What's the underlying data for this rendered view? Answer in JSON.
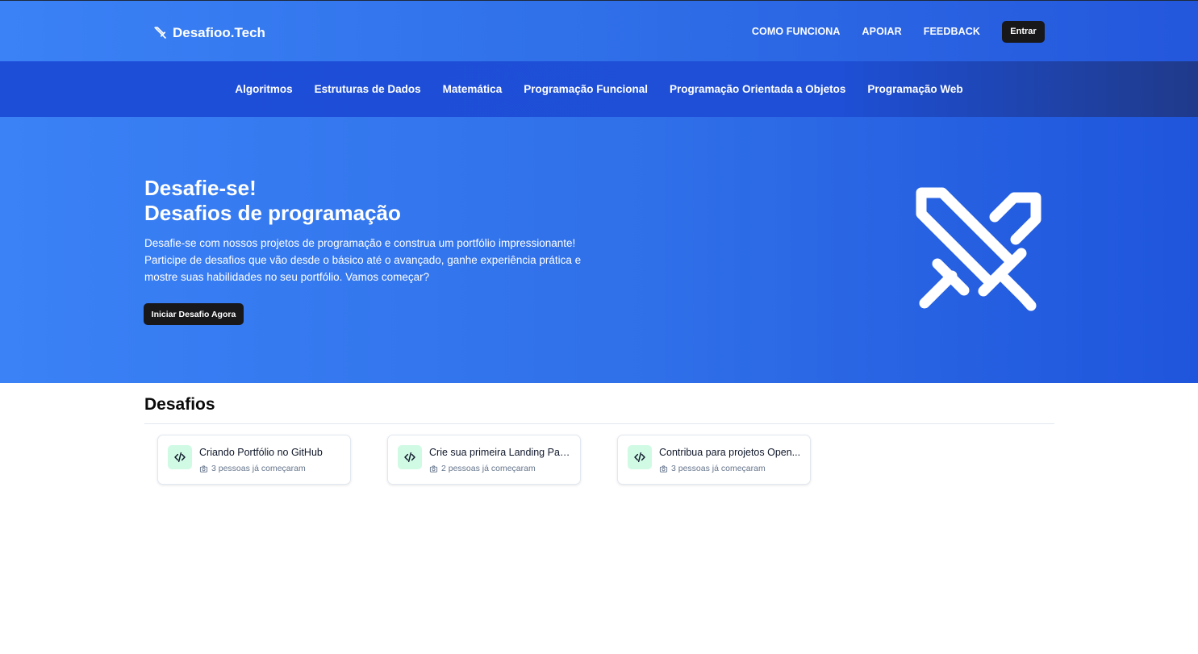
{
  "header": {
    "brand": "Desafioo.Tech",
    "brand_icon": "sword-icon",
    "nav": [
      "COMO FUNCIONA",
      "APOIAR",
      "FEEDBACK"
    ],
    "login_label": "Entrar"
  },
  "categories": [
    "Algoritmos",
    "Estruturas de Dados",
    "Matemática",
    "Programação Funcional",
    "Programação Orientada a Objetos",
    "Programação Web"
  ],
  "hero": {
    "title_line1": "Desafie-se!",
    "title_line2": "Desafios de programação",
    "description": "Desafie-se com nossos projetos de programação e construa um portfólio impressionante! Participe de desafios que vão desde o básico até o avançado, ganhe experiência prática e mostre suas habilidades no seu portfólio. Vamos começar?",
    "cta_label": "Iniciar Desafio Agora",
    "illustration_icon": "crossed-swords-icon"
  },
  "challenges": {
    "section_title": "Desafios",
    "items": [
      {
        "title": "Criando Portfólio no GitHub",
        "meta": "3 pessoas já começaram",
        "icon": "code-icon"
      },
      {
        "title": "Crie sua primeira Landing Pag...",
        "meta": "2 pessoas já começaram",
        "icon": "code-icon"
      },
      {
        "title": "Contribua para projetos Open...",
        "meta": "3 pessoas já começaram",
        "icon": "code-icon"
      }
    ]
  },
  "colors": {
    "primary": "#3b82f6",
    "primary_dark": "#1d4ed8",
    "button_dark": "#18181b",
    "card_icon_bg": "#d1fae5"
  }
}
